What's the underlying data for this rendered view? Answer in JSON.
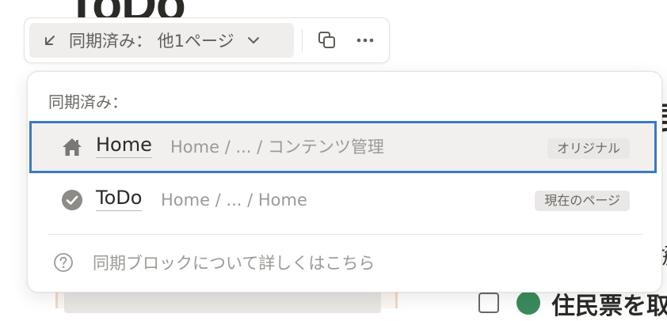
{
  "page": {
    "title": "ToDo",
    "right_big_char": "毘",
    "right_mid_char": "協",
    "bottom_partial_text": "住民票を取"
  },
  "toolbar": {
    "sync_label": "同期済み： 他1ページ",
    "copy_icon": "copy-icon",
    "more_icon": "more-horizontal-icon"
  },
  "menu": {
    "header": "同期済み：",
    "items": [
      {
        "icon": "home-icon",
        "title": "Home",
        "path": "Home / ... / コンテンツ管理",
        "badge": "オリジナル",
        "selected": true
      },
      {
        "icon": "check-circle-icon",
        "title": "ToDo",
        "path": "Home / ... / Home",
        "badge": "現在のページ",
        "selected": false
      }
    ],
    "help_text": "同期ブロックについて詳しくはこちら"
  },
  "colors": {
    "accent_selection": "#3b7ac2",
    "muted_text": "#9b9a96",
    "badge_bg": "#e9e8e6"
  }
}
